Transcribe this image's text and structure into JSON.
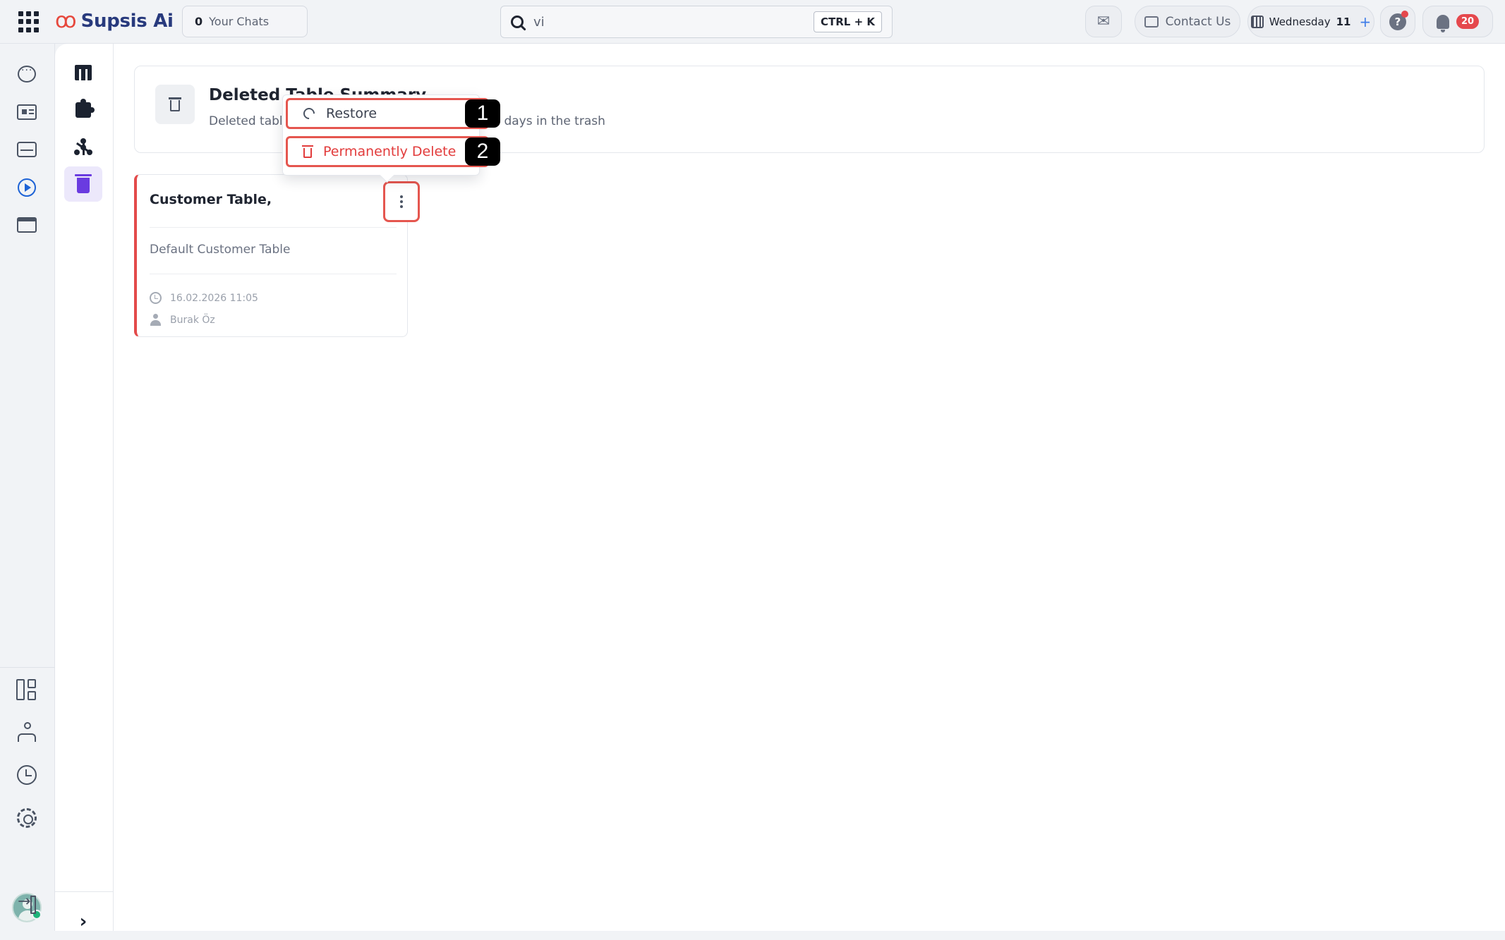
{
  "topbar": {
    "logo_text": "Supsis Ai",
    "chats_count": "0",
    "chats_label": "Your Chats",
    "search_value": "vi",
    "search_shortcut": "CTRL + K",
    "contact_label": "Contact Us",
    "day_name": "Wednesday",
    "day_number": "11",
    "notification_count": "20"
  },
  "header": {
    "title": "Deleted Table Summary",
    "description": "Deleted tables are permanently deleted after 30 days in the trash"
  },
  "card": {
    "title": "Customer Table,",
    "description": "Default Customer Table",
    "date": "16.02.2026 11:05",
    "user": "Burak Öz"
  },
  "menu": {
    "restore_label": "Restore",
    "delete_label": "Permanently Delete"
  },
  "markers": {
    "first": "1",
    "second": "2"
  },
  "colors": {
    "accent_red": "#e5564f",
    "delete_red": "#e23c3c",
    "active_purple": "#6a3be0",
    "brand_navy": "#283a7d"
  }
}
